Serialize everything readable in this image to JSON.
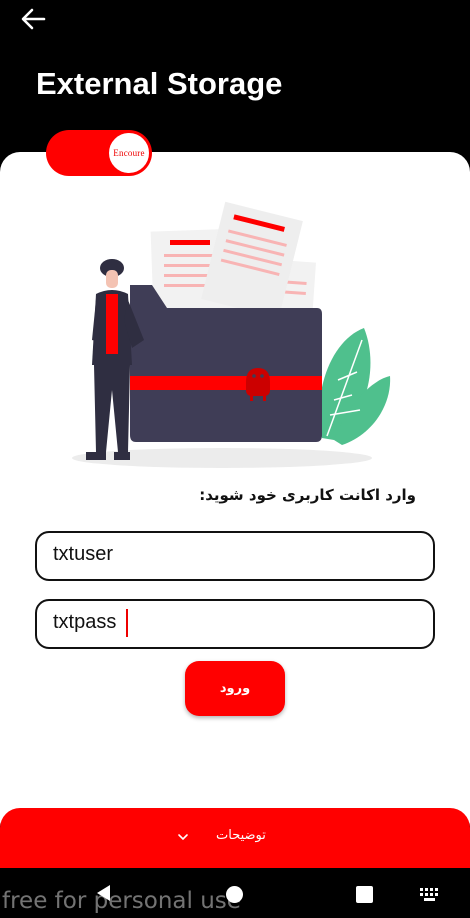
{
  "header": {
    "title": "External Storage"
  },
  "toggle": {
    "knob_text": "Encoure",
    "state": "on",
    "color": "#ff0000"
  },
  "form": {
    "prompt": "وارد اکانت کاربری خود شوید:",
    "username_value": "txtuser",
    "password_value": "txtpass",
    "login_label": "ورود"
  },
  "bottom_panel": {
    "label": "توضیحات"
  },
  "watermark": "free for personal use",
  "colors": {
    "accent": "#ff0000",
    "background": "#000000",
    "card": "#ffffff",
    "leaf": "#4fc08d",
    "folder": "#3f3d56"
  },
  "icons": [
    "back-arrow-icon",
    "android-icon",
    "chevron-down-icon",
    "nav-back-icon",
    "nav-home-icon",
    "nav-recent-icon",
    "keyboard-icon"
  ]
}
